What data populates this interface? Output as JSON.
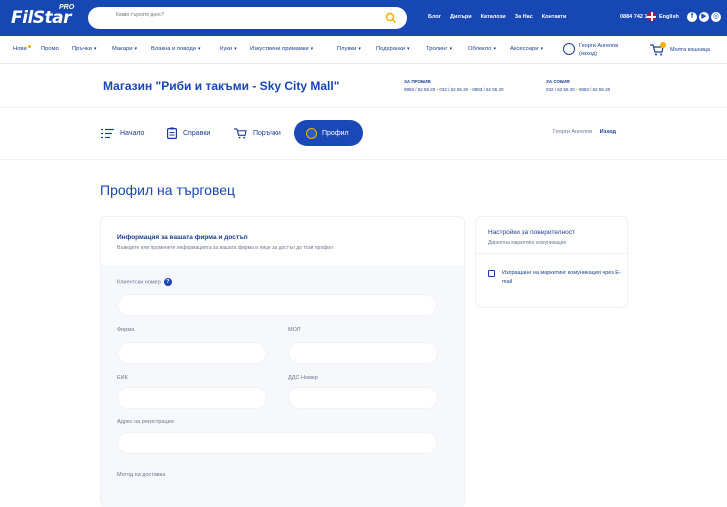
{
  "header": {
    "logo_text": "FilStar",
    "logo_badge": "PRO",
    "search_placeholder": "Какво търсите днес?",
    "links": [
      "Блог",
      "Дилъри",
      "Каталози",
      "За Нас",
      "Контакти"
    ],
    "phone": "0884 742 185",
    "language": "English",
    "colors": {
      "primary": "#1747b3",
      "accent": "#f5b000"
    }
  },
  "nav": {
    "items": [
      {
        "label": "Нови",
        "dropdown": false
      },
      {
        "label": "Промо",
        "dropdown": false
      },
      {
        "label": "Пръчки",
        "dropdown": true
      },
      {
        "label": "Макари",
        "dropdown": true
      },
      {
        "label": "Влакна и поводи",
        "dropdown": true
      },
      {
        "label": "Куки",
        "dropdown": true
      },
      {
        "label": "Изкуствени примамки",
        "dropdown": true
      },
      {
        "label": "Плувки",
        "dropdown": true
      },
      {
        "label": "Подхранки",
        "dropdown": true
      },
      {
        "label": "Тролинг",
        "dropdown": true
      },
      {
        "label": "Облекло",
        "dropdown": true
      },
      {
        "label": "Аксесоари",
        "dropdown": true
      }
    ],
    "chevron": "▾",
    "user_name": "Георги Ангелов",
    "user_action": "(изход)",
    "cart_label": "Моята кошница"
  },
  "store": {
    "title": "Магазин \"Риби и такъми - Sky City Mall\"",
    "fishing_label": "ЗА ПРОБИВ",
    "fishing_phones": [
      "0893 / 62 55 20",
      "032 / 62 55 20",
      "0893 / 62 55 20"
    ],
    "sales_label": "ЗА СОБИЯ",
    "sales_phones": [
      "032 / 62 55 20",
      "0893 / 62 55 20"
    ]
  },
  "tabs": {
    "items": [
      "Начало",
      "Справки",
      "Поръчки",
      "Профил"
    ],
    "active": "Профил",
    "user": "Георги Ангелов",
    "logout": "Изход"
  },
  "page": {
    "title": "Профил на търговец"
  },
  "company_card": {
    "title": "Информация за вашата фирма и достъп",
    "subtitle": "Въведете или променете информацията за вашата фирма и лице за достъп до този профил",
    "fields": {
      "client_number": "Клиентски номер",
      "company": "Фирма",
      "mol": "МОЛ",
      "eik": "ЕИК",
      "vat": "ДДС Номер",
      "address": "Адрес на регистрация",
      "delivery": "Метод на доставка"
    }
  },
  "privacy_card": {
    "title": "Настройки за поверителност",
    "subtitle": "Директна маркетинг комуникация",
    "checkbox_label": "Изпращане на маркетинг комуникация чрез E-mail",
    "checked": false
  }
}
